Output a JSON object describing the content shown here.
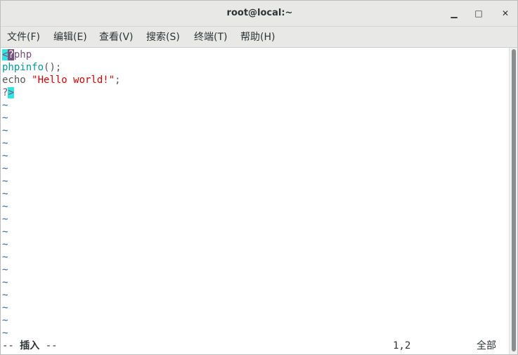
{
  "window": {
    "title": "root@local:~",
    "minimize_glyph": "▁",
    "maximize_glyph": "□",
    "close_glyph": "✕"
  },
  "menu": [
    {
      "label": "文件(F)"
    },
    {
      "label": "编辑(E)"
    },
    {
      "label": "查看(V)"
    },
    {
      "label": "搜索(S)"
    },
    {
      "label": "终端(T)"
    },
    {
      "label": "帮助(H)"
    }
  ],
  "editor": {
    "line1": {
      "open": "<",
      "q": "?",
      "rest": "php"
    },
    "line2": {
      "func": "phpinfo",
      "parens": "();"
    },
    "line3": {
      "kw": "echo ",
      "str": "\"Hello world!\"",
      "end": ";"
    },
    "line4": {
      "q": "?",
      "close": ">"
    },
    "tilde": "~"
  },
  "status": {
    "prefix": "-- ",
    "mode": "插入",
    "suffix": " --",
    "position": "1,2",
    "scope": "全部"
  },
  "colors": {
    "keyword": "#75507b",
    "function": "#06989a",
    "string": "#cc0000",
    "tilde": "#3465a4",
    "highlight": "#34e2e2"
  }
}
